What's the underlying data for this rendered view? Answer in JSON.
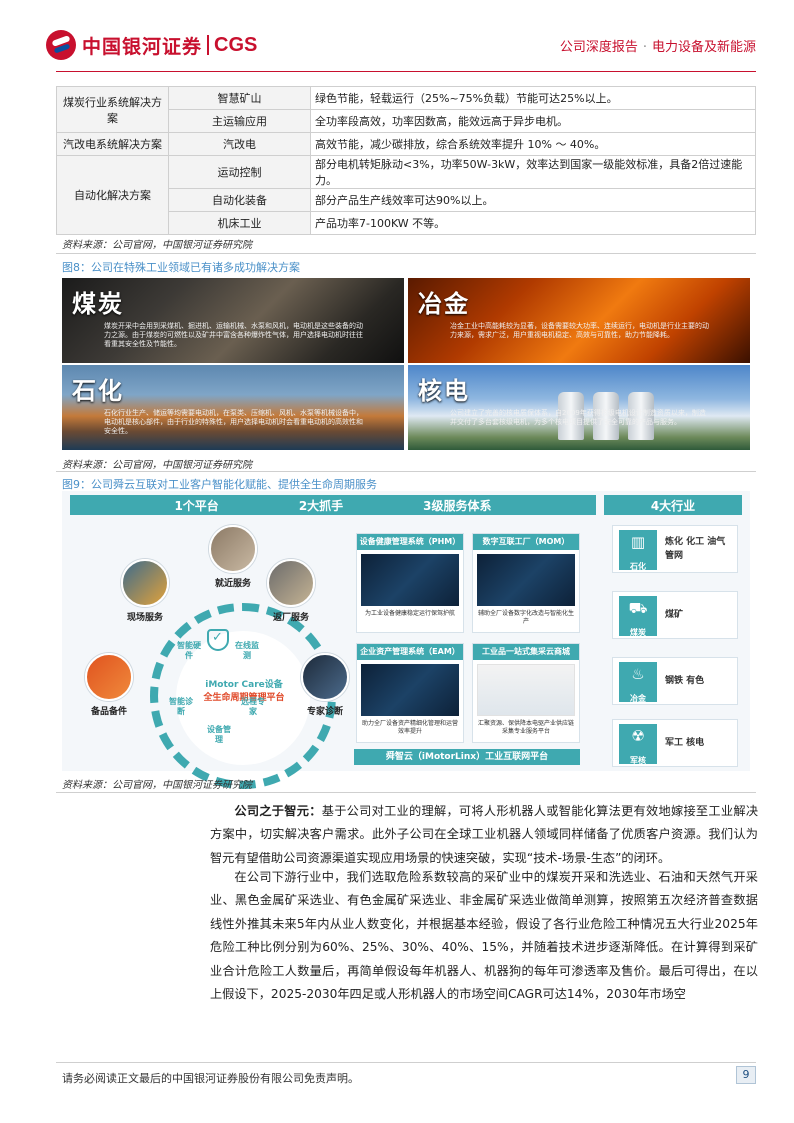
{
  "header": {
    "logo_text": "中国银河证券",
    "logo_en": "CGS",
    "report_type": "公司深度报告",
    "separator": "·",
    "sector": "电力设备及新能源"
  },
  "table": {
    "rows": [
      {
        "col1": "煤炭行业系统解决方案",
        "col2": "智慧矿山",
        "col3": "绿色节能，轻载运行（25%~75%负载）节能可达25%以上。"
      },
      {
        "col2": "主运输应用",
        "col3": "全功率段高效，功率因数高，能效远高于异步电机。"
      },
      {
        "col1": "汽改电系统解决方案",
        "col2": "汽改电",
        "col3": "高效节能，减少碳排放，综合系统效率提升 10% ～ 40%。"
      },
      {
        "col1": "自动化解决方案",
        "col2": "运动控制",
        "col3": "部分电机转矩脉动<3%，功率50W-3kW，效率达到国家一级能效标准，具备2倍过速能力。"
      },
      {
        "col2": "自动化装备",
        "col3": "部分产品生产线效率可达90%以上。"
      },
      {
        "col2": "机床工业",
        "col3": "产品功率7-100KW 不等。"
      }
    ],
    "source": "资料来源：公司官网，中国银河证券研究院"
  },
  "fig8": {
    "title": "图8：公司在特殊工业领域已有诸多成功解决方案",
    "panels": [
      {
        "title": "煤炭",
        "desc": "煤炭开采中会用到采煤机、掘进机、运输机械、水泵和风机，电动机是这些装备的动力之源。由于煤炭的可燃性以及矿井中富含各种爆炸性气体，用户选择电动机时往往看重其安全性及节能性。"
      },
      {
        "title": "冶金",
        "desc": "冶金工业中高能耗较为显著，设备需要较大功率、连续运行，电动机是行业主要的动力来源，需求广泛，用户重视电机稳定、高效与可靠性，助力节能降耗。"
      },
      {
        "title": "石化",
        "desc": "石化行业生产、储运等均需要电动机，在泵类、压缩机、风机、水泵等机械设备中，电动机是核心部件，由于行业的特殊性，用户选择电动机时会看重电动机的高效性和安全性。"
      },
      {
        "title": "核电",
        "desc": "公司建立了完善的核电质保体系，自2009年获得核级电机设计制造资质以来，制造并交付了多台套核级电机，为多个核电项目提供了安全可靠的产品与服务。"
      }
    ],
    "source": "资料来源：公司官网，中国银河证券研究院"
  },
  "fig9": {
    "title": "图9：公司舜云互联对工业客户智能化赋能、提供全生命周期服务",
    "banners": [
      "1个平台",
      "2大抓手",
      "3级服务体系",
      "4大行业"
    ],
    "ring": {
      "title": "iMotor Care设备",
      "subtitle": "全生命周期管理平台",
      "labels": [
        "智能硬件",
        "在线监测",
        "智能诊断",
        "远程专家",
        "设备管理"
      ]
    },
    "services": [
      "就近服务",
      "现场服务",
      "返厂服务",
      "备品备件",
      "专家诊断"
    ],
    "cards": [
      {
        "title": "设备健康管理系统（PHM）",
        "desc": "为工业设备健康稳定运行保驾护航"
      },
      {
        "title": "数字互联工厂（MOM）",
        "desc": "辅助全厂设备数字化改造与智能化生产"
      },
      {
        "title": "企业资产管理系统（EAM）",
        "desc": "助力全厂设备资产精细化管理和运营效率提升"
      },
      {
        "title": "工业品一站式集采云商城",
        "desc": "汇聚资源、保供降本电驱产业供应链采集专业服务平台"
      }
    ],
    "bottom_bar": "舜智云（iMotorLinx）工业互联网平台",
    "industries": [
      {
        "name": "石化",
        "text": "炼化 化工 油气 管网",
        "icon": "refinery-icon"
      },
      {
        "name": "煤炭",
        "text": "煤矿",
        "icon": "mining-cart-icon"
      },
      {
        "name": "冶金",
        "text": "钢铁 有色",
        "icon": "furnace-icon"
      },
      {
        "name": "军核",
        "text": "军工 核电",
        "icon": "nuclear-plant-icon"
      }
    ],
    "source": "资料来源：公司官网，中国银河证券研究院"
  },
  "body": {
    "p1_lead": "公司之于智元：",
    "p1": "基于公司对工业的理解，可将人形机器人或智能化算法更有效地嫁接至工业解决方案中，切实解决客户需求。此外子公司在全球工业机器人领域同样储备了优质客户资源。我们认为智元有望借助公司资源渠道实现应用场景的快速突破，实现“技术-场景-生态”的闭环。",
    "p2": "在公司下游行业中，我们选取危险系数较高的采矿业中的煤炭开采和洗选业、石油和天然气开采业、黑色金属矿采选业、有色金属矿采选业、非金属矿采选业做简单测算，按照第五次经济普查数据线性外推其未来5年内从业人数变化，并根据基本经验，假设了各行业危险工种情况五大行业2025年危险工种比例分别为60%、25%、30%、40%、15%，并随着技术进步逐渐降低。在计算得到采矿业合计危险工人数量后，再简单假设每年机器人、机器狗的每年可渗透率及售价。最后可得出，在以上假设下，2025-2030年四足或人形机器人的市场空间CAGR可达14%，2030年市场空"
  },
  "footer": {
    "disclaimer": "请务必阅读正文最后的中国银河证券股份有限公司免责声明。",
    "page": "9"
  },
  "colors": {
    "brand_red": "#c8102e",
    "accent_teal": "#3fa9b0",
    "caption_blue": "#4a90c8"
  }
}
